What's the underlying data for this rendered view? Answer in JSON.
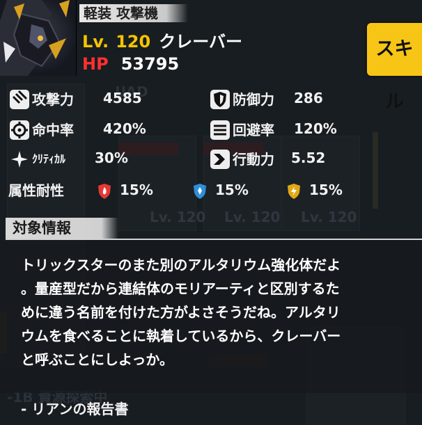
{
  "unit": {
    "class_tag": "軽装 攻撃機",
    "level_label": "Lv.",
    "level_value": "120",
    "name": "クレーバー",
    "hp_label": "HP",
    "hp_value": "53795"
  },
  "skill_button": "スキル",
  "stats": [
    {
      "icon": "attack-icon",
      "label": "攻撃力",
      "value": "4585"
    },
    {
      "icon": "defense-icon",
      "label": "防御力",
      "value": "286"
    },
    {
      "icon": "accuracy-icon",
      "label": "命中率",
      "value": "420%"
    },
    {
      "icon": "evasion-icon",
      "label": "回避率",
      "value": "120%"
    },
    {
      "icon": "critical-icon",
      "label": "ｸﾘﾃｨｶﾙ",
      "value": "30%"
    },
    {
      "icon": "speed-icon",
      "label": "行動力",
      "value": "5.52"
    }
  ],
  "resistance": {
    "label": "属性耐性",
    "items": [
      {
        "icon": "fire-resist-icon",
        "value": "15%",
        "color": "#e53935"
      },
      {
        "icon": "ice-resist-icon",
        "value": "15%",
        "color": "#2f8fd8"
      },
      {
        "icon": "electric-resist-icon",
        "value": "15%",
        "color": "#e0a814"
      }
    ]
  },
  "info": {
    "header": "対象情報",
    "lines": [
      "トリックスターのまた別のアルタリウム強化体だよ",
      "。量産型だから連結体のモリアーティと区別するた",
      "めに違う名前を付けた方がよさそうだね。アルタリ",
      "ウムを食べることに執着しているから、クレーバー",
      "と呼ぶことにしよっか。"
    ],
    "signature": "- リアンの報告書"
  },
  "colors": {
    "accent_yellow": "#f6c516",
    "hp_red": "#ff3030",
    "level_yellow": "#f5c400"
  }
}
